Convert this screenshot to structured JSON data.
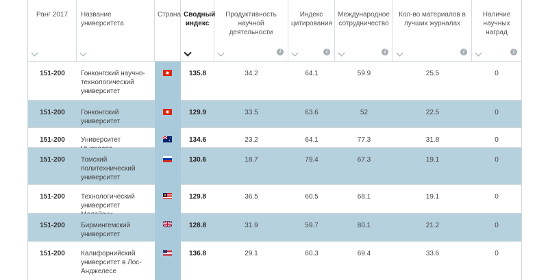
{
  "headers": {
    "rank": "Ранг 2017",
    "name": "Название университета",
    "country": "Страна",
    "overall": "Сводный индекс",
    "productivity": "Продуктивность научной деятельности",
    "citation": "Индекс цитирования",
    "international": "Международное сотрудничество",
    "journals": "Кол-во материалов в лучших журналах",
    "awards": "Наличие научных наград"
  },
  "rows": [
    {
      "rank": "151-200",
      "name": "Гонконгский научно-технологический университет",
      "flag": "hk-flag-icon",
      "overall": "135.8",
      "productivity": "34.2",
      "citation": "64.1",
      "international": "59.9",
      "journals": "25.5",
      "awards": "0"
    },
    {
      "rank": "151-200",
      "name": "Гонконгский университет",
      "flag": "hk-flag-icon",
      "overall": "129.9",
      "productivity": "33.5",
      "citation": "63.6",
      "international": "52",
      "journals": "22.5",
      "awards": "0"
    },
    {
      "rank": "151-200",
      "name": "Университет Ньюкасла",
      "flag": "au-flag-icon",
      "overall": "134.6",
      "productivity": "23.2",
      "citation": "64.1",
      "international": "77.3",
      "journals": "31.8",
      "awards": "0"
    },
    {
      "rank": "151-200",
      "name": "Томский политехнический университет",
      "flag": "ru-flag-icon",
      "overall": "130.6",
      "productivity": "18.7",
      "citation": "79.4",
      "international": "67.3",
      "journals": "19.1",
      "awards": "0"
    },
    {
      "rank": "151-200",
      "name": "Технологический университет Малайзии",
      "flag": "my-flag-icon",
      "overall": "129.8",
      "productivity": "36.5",
      "citation": "60.5",
      "international": "68.1",
      "journals": "19.1",
      "awards": "0"
    },
    {
      "rank": "151-200",
      "name": "Бирмингемский университет",
      "flag": "uk-flag-icon",
      "overall": "128.8",
      "productivity": "31.9",
      "citation": "59.7",
      "international": "80.1",
      "journals": "21.2",
      "awards": "0"
    },
    {
      "rank": "151-200",
      "name": "Калифорнийский университет в Лос-Анджелесе",
      "flag": "us-flag-icon",
      "overall": "136.8",
      "productivity": "29.1",
      "citation": "60.3",
      "international": "69.4",
      "journals": "33.6",
      "awards": "0"
    }
  ],
  "icons": {
    "sort": "chevron-down-icon",
    "info": "info-icon",
    "info_glyph": "i"
  },
  "colors": {
    "row_highlight": "#b6d1de",
    "country_band": "#a9cadb",
    "border": "#cfd8dc"
  }
}
